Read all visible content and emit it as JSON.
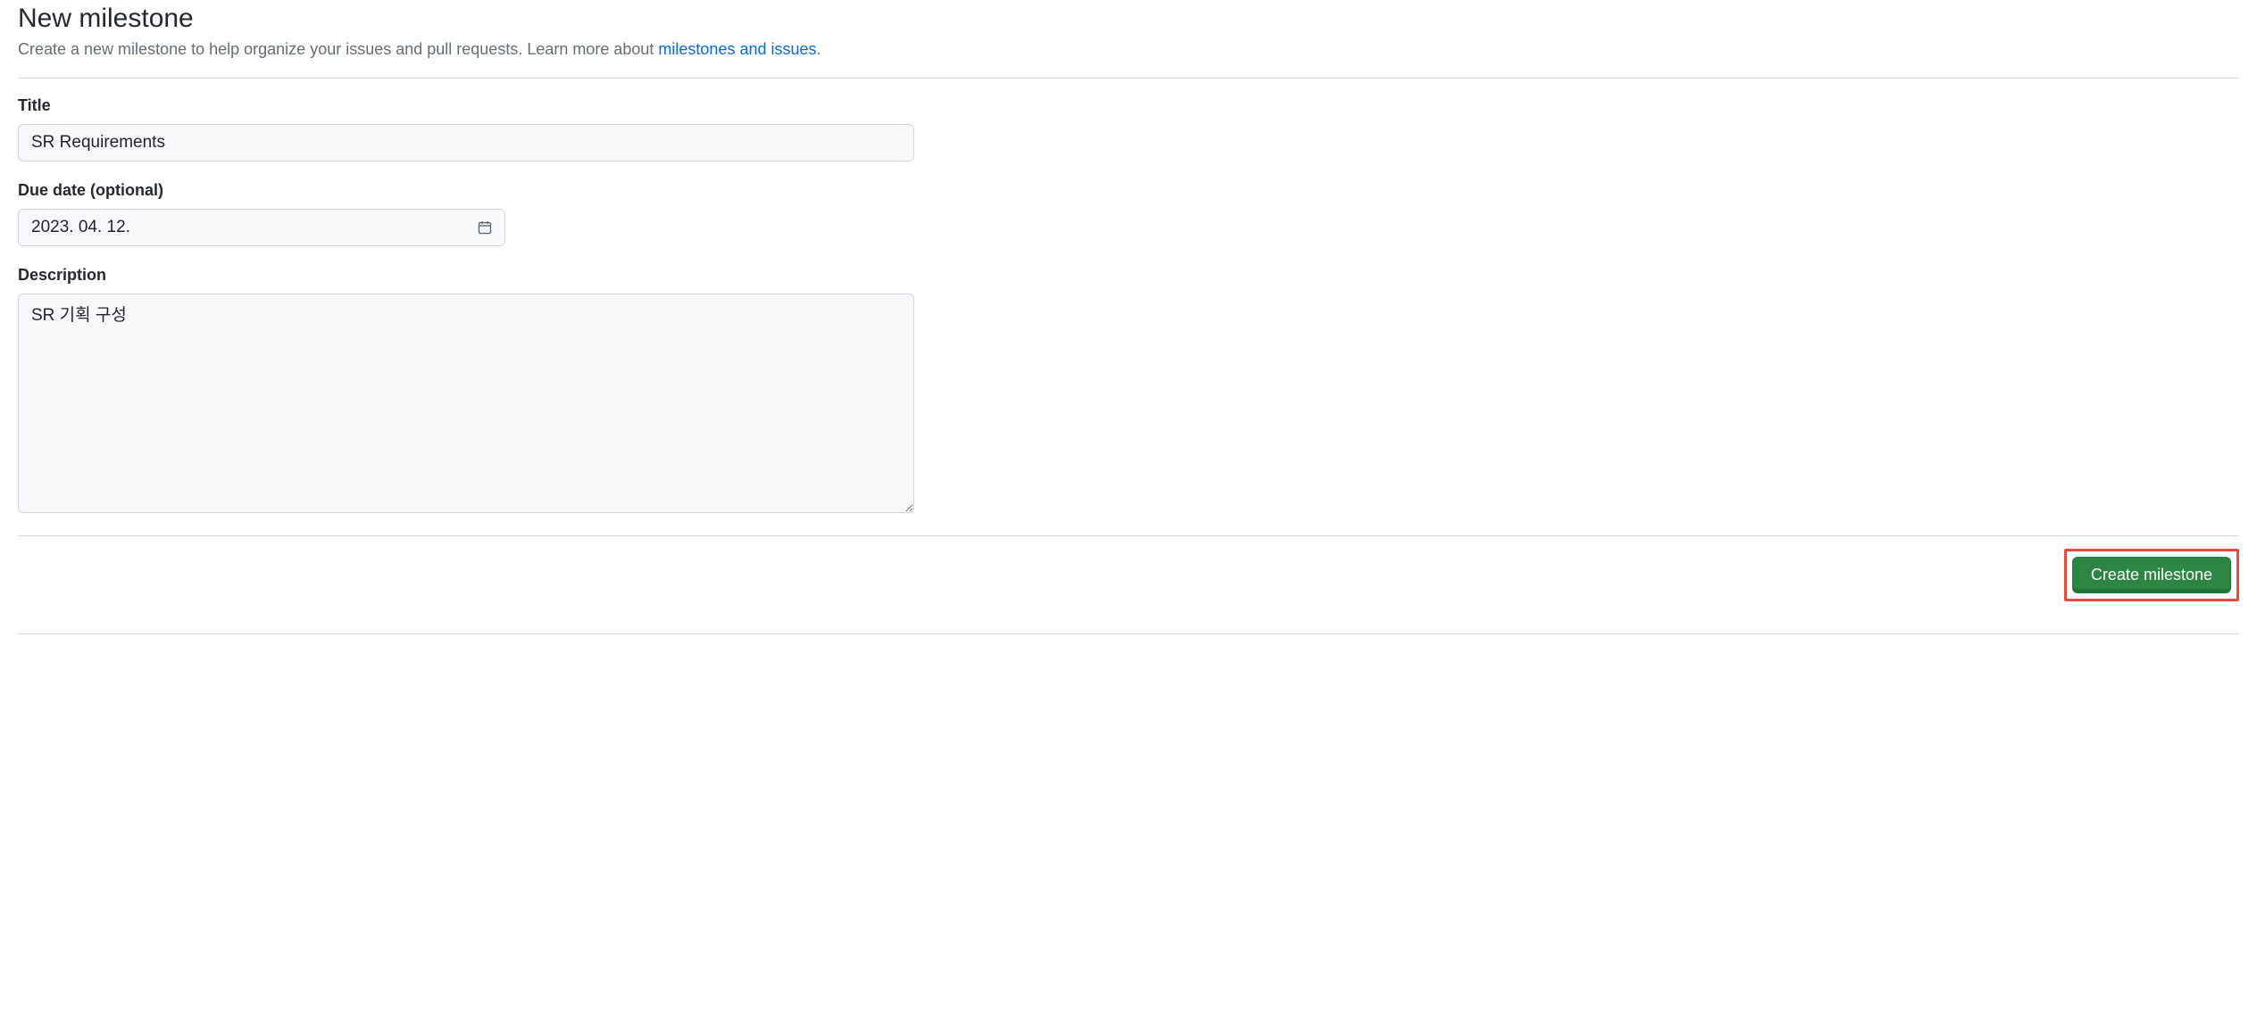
{
  "header": {
    "title": "New milestone",
    "subtitle_prefix": "Create a new milestone to help organize your issues and pull requests. Learn more about ",
    "subtitle_link": "milestones and issues",
    "subtitle_suffix": "."
  },
  "form": {
    "title": {
      "label": "Title",
      "value": "SR Requirements"
    },
    "due_date": {
      "label": "Due date (optional)",
      "value": "2023. 04. 12."
    },
    "description": {
      "label": "Description",
      "value": "SR 기획 구성"
    }
  },
  "actions": {
    "submit_label": "Create milestone"
  }
}
